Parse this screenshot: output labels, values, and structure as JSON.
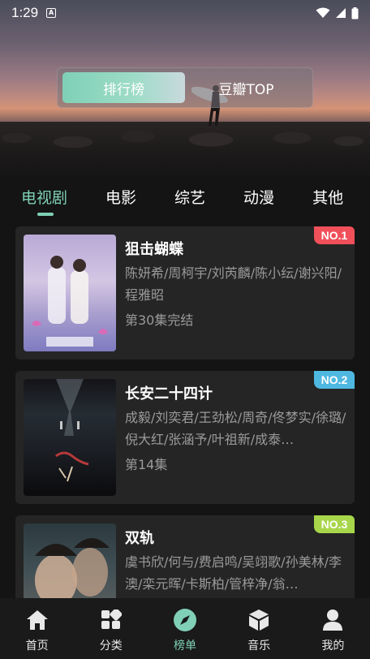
{
  "status_bar": {
    "time": "1:29",
    "notif_icon": "a-icon"
  },
  "segment": {
    "options": [
      "排行榜",
      "豆瓣TOP"
    ],
    "selected": 0,
    "accent": "#7fd0b6"
  },
  "tabs": [
    "电视剧",
    "电影",
    "综艺",
    "动漫",
    "其他"
  ],
  "active_tab": 0,
  "items": [
    {
      "rank": "NO.1",
      "rank_color": "#f0505a",
      "title": "狙击蝴蝶",
      "cast": "陈妍希/周柯宇/刘芮麟/陈小纭/谢兴阳/程雅昭",
      "status": "第30集完结"
    },
    {
      "rank": "NO.2",
      "rank_color": "#4fb8e0",
      "title": "长安二十四计",
      "cast": "成毅/刘奕君/王劲松/周奇/佟梦实/徐璐/倪大红/张涵予/叶祖新/成泰…",
      "status": "第14集"
    },
    {
      "rank": "NO.3",
      "rank_color": "#a8d64a",
      "title": "双轨",
      "cast": "虞书欣/何与/费启鸣/吴翊歌/孙美林/李澳/栾元晖/卡斯柏/管梓净/翁…",
      "status": ""
    }
  ],
  "bottom_nav": [
    {
      "label": "首页",
      "icon": "home-icon"
    },
    {
      "label": "分类",
      "icon": "grid-icon"
    },
    {
      "label": "榜单",
      "icon": "compass-icon"
    },
    {
      "label": "音乐",
      "icon": "cube-icon"
    },
    {
      "label": "我的",
      "icon": "person-icon"
    }
  ],
  "bottom_nav_active": 2
}
